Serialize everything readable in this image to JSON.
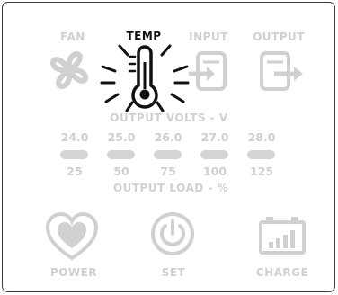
{
  "indicators": {
    "fan_label": "FAN",
    "temp_label": "TEMP",
    "input_label": "INPUT",
    "output_label": "OUTPUT",
    "active": "TEMP"
  },
  "output_volts": {
    "title": "OUTPUT VOLTS - V",
    "values": [
      "24.0",
      "25.0",
      "26.0",
      "27.0",
      "28.0"
    ]
  },
  "output_load": {
    "title": "OUTPUT LOAD - %",
    "values": [
      "25",
      "50",
      "75",
      "100",
      "125"
    ]
  },
  "bottom": {
    "power_label": "POWER",
    "set_label": "SET",
    "charge_label": "CHARGE"
  },
  "colors": {
    "active": "#111111",
    "inactive": "#d0d0d0",
    "border": "#3a3a3a"
  }
}
